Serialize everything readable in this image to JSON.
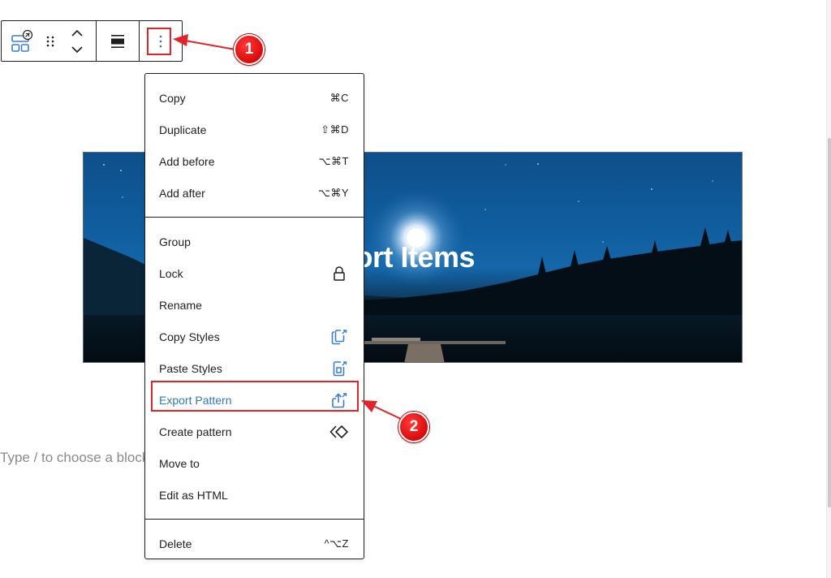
{
  "toolbar": {
    "block_type_icon": "cover-block-icon",
    "drag_handle_icon": "drag-handle-icon",
    "move_up_icon": "chevron-up-icon",
    "move_down_icon": "chevron-down-icon",
    "align_icon": "align-full-width-icon",
    "more_options_icon": "more-vertical-icon"
  },
  "cover": {
    "title": "Export Items"
  },
  "editor": {
    "placeholder": "Type / to choose a block"
  },
  "menu": {
    "sections": [
      {
        "items": [
          {
            "label": "Copy",
            "shortcut": "⌘C"
          },
          {
            "label": "Duplicate",
            "shortcut": "⇧⌘D"
          },
          {
            "label": "Add before",
            "shortcut": "⌥⌘T"
          },
          {
            "label": "Add after",
            "shortcut": "⌥⌘Y"
          }
        ]
      },
      {
        "items": [
          {
            "label": "Group",
            "shortcut": ""
          },
          {
            "label": "Lock",
            "icon": "lock-icon"
          },
          {
            "label": "Rename",
            "shortcut": ""
          },
          {
            "label": "Copy Styles",
            "icon": "copy-styles-icon"
          },
          {
            "label": "Paste Styles",
            "icon": "paste-styles-icon"
          },
          {
            "label": "Export Pattern",
            "icon": "export-pattern-icon",
            "active": true
          },
          {
            "label": "Create pattern",
            "icon": "create-pattern-icon"
          },
          {
            "label": "Move to",
            "shortcut": ""
          },
          {
            "label": "Edit as HTML",
            "shortcut": ""
          }
        ]
      },
      {
        "items": [
          {
            "label": "Delete",
            "shortcut": "^⌥Z"
          }
        ]
      }
    ]
  },
  "annotations": {
    "step1": "1",
    "step2": "2",
    "highlight_color": "#e0242a"
  },
  "colors": {
    "accent": "#2f79b4",
    "plugin_icon": "#3a7fd0",
    "text": "#1e1e1e",
    "placeholder": "#8a8a8a"
  }
}
